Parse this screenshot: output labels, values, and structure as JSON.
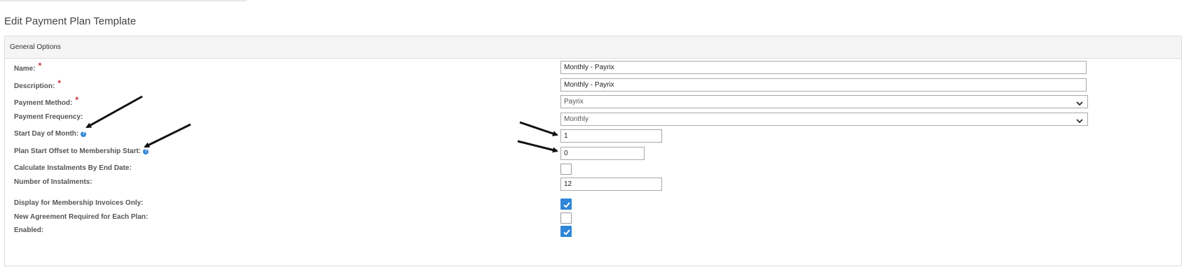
{
  "page_title": "Edit Payment Plan Template",
  "panel": {
    "title": "General Options"
  },
  "fields": {
    "name": {
      "label": "Name:",
      "required": "*",
      "value": "Monthly - Payrix"
    },
    "description": {
      "label": "Description:",
      "required": "*",
      "value": "Monthly - Payrix"
    },
    "payment_method": {
      "label": "Payment Method:",
      "required": "*",
      "value": "Payrix"
    },
    "payment_frequency": {
      "label": "Payment Frequency:",
      "value": "Monthly"
    },
    "start_day_of_month": {
      "label": "Start Day of Month:",
      "value": "1"
    },
    "plan_start_offset": {
      "label": "Plan Start Offset to Membership Start:",
      "value": "0"
    },
    "calculate_by_end_date": {
      "label": "Calculate Instalments By End Date:",
      "checked": false
    },
    "number_of_instalments": {
      "label": "Number of Instalments:",
      "value": "12"
    },
    "membership_invoices_only": {
      "label": "Display for Membership Invoices Only:",
      "checked": true
    },
    "new_agreement_required": {
      "label": "New Agreement Required for Each Plan:",
      "checked": false
    },
    "enabled": {
      "label": "Enabled:",
      "checked": true
    }
  },
  "icons": {
    "help": "question-circle-icon",
    "chevron": "chevron-down-icon",
    "check": "check-icon"
  },
  "colors": {
    "accent": "#2f86d6",
    "required": "#c9302c",
    "panel_header_bg": "#f5f5f5"
  }
}
